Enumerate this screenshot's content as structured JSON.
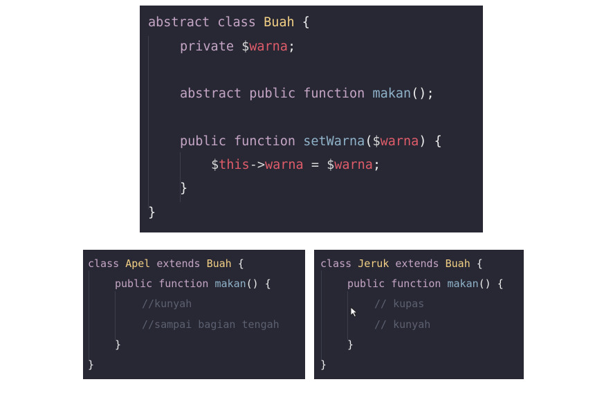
{
  "colors": {
    "panel_bg": "#272834",
    "keyword": "#c5a5c5",
    "class_name": "#f2cf85",
    "function_name": "#8fb2c9",
    "variable": "#e05c6a",
    "comment": "#5d6070"
  },
  "main": {
    "l1": {
      "kw1": "abstract",
      "kw2": "class",
      "cls": "Buah",
      "brace": "{"
    },
    "l2": {
      "kw": "private",
      "dollar": "$",
      "var": "warna",
      "semi": ";"
    },
    "l3": {
      "kw1": "abstract",
      "kw2": "public",
      "kw3": "function",
      "fn": "makan",
      "rest": "();"
    },
    "l4": {
      "kw1": "public",
      "kw2": "function",
      "fn": "setWarna",
      "p1": "(",
      "dollar": "$",
      "var": "warna",
      "p2": ")",
      "brace": "{"
    },
    "l5": {
      "dollar1": "$",
      "this": "this",
      "arrow": "->",
      "prop": "warna",
      "eq": "=",
      "dollar2": "$",
      "var": "warna",
      "semi": ";"
    },
    "l6": {
      "brace": "}"
    },
    "l7": {
      "brace": "}"
    }
  },
  "apel": {
    "l1": {
      "kw1": "class",
      "cls": "Apel",
      "kw2": "extends",
      "parent": "Buah",
      "brace": "{"
    },
    "l2": {
      "kw1": "public",
      "kw2": "function",
      "fn": "makan",
      "rest": "()",
      "brace": "{"
    },
    "l3": {
      "comment": "//kunyah"
    },
    "l4": {
      "comment": "//sampai bagian tengah"
    },
    "l5": {
      "brace": "}"
    },
    "l6": {
      "brace": "}"
    }
  },
  "jeruk": {
    "l1": {
      "kw1": "class",
      "cls": "Jeruk",
      "kw2": "extends",
      "parent": "Buah",
      "brace": "{"
    },
    "l2": {
      "kw1": "public",
      "kw2": "function",
      "fn": "makan",
      "rest": "()",
      "brace": "{"
    },
    "l3": {
      "comment": "// kupas"
    },
    "l4": {
      "comment": "// kunyah"
    },
    "l5": {
      "brace": "}"
    },
    "l6": {
      "brace": "}"
    }
  }
}
